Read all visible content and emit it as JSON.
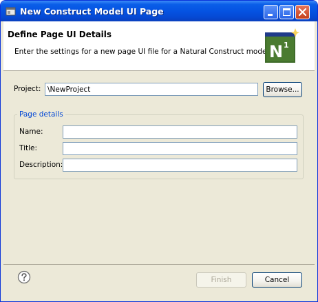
{
  "window": {
    "title": "New Construct Model UI Page"
  },
  "header": {
    "title": "Define Page UI Details",
    "description": "Enter the settings for a new page UI file for a Natural Construct model.",
    "logo_text": "N",
    "logo_superscript": "1"
  },
  "project": {
    "label": "Project:",
    "value": "\\NewProject",
    "browse_label": "Browse..."
  },
  "page_details": {
    "group_label": "Page details",
    "name_label": "Name:",
    "name_value": "",
    "title_label": "Title:",
    "title_value": "",
    "description_label": "Description:",
    "description_value": ""
  },
  "footer": {
    "finish_label": "Finish",
    "cancel_label": "Cancel"
  },
  "colors": {
    "title_bar": "#0553e2",
    "dialog_bg": "#ece9d8",
    "group_title": "#0046d5",
    "logo_bg": "#3f6b2a"
  }
}
